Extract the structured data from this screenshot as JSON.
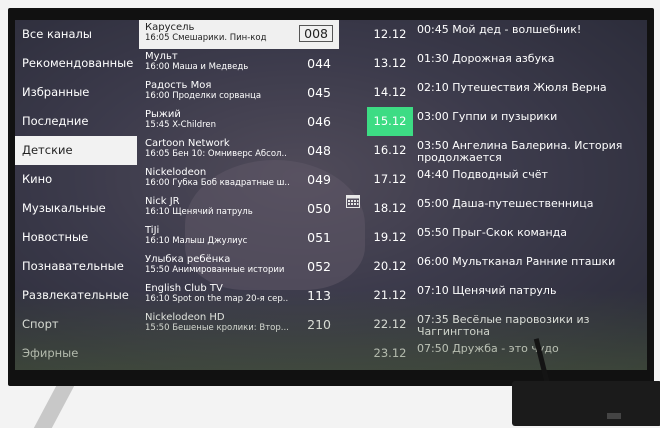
{
  "categories": [
    {
      "label": "Все каналы"
    },
    {
      "label": "Рекомендованные"
    },
    {
      "label": "Избранные"
    },
    {
      "label": "Последние"
    },
    {
      "label": "Детские",
      "active": true
    },
    {
      "label": "Кино"
    },
    {
      "label": "Музыкальные"
    },
    {
      "label": "Новостные"
    },
    {
      "label": "Познавательные"
    },
    {
      "label": "Развлекательные"
    },
    {
      "label": "Спорт"
    },
    {
      "label": "Эфирные"
    }
  ],
  "channels": [
    {
      "name": "Карусель",
      "program": "16:05 Смешарики. Пин-код",
      "number": "008",
      "active": true
    },
    {
      "name": "Мульт",
      "program": "16:00 Маша и Медведь",
      "number": "044"
    },
    {
      "name": "Радость Моя",
      "program": "16:00 Проделки сорванца",
      "number": "045"
    },
    {
      "name": "Рыжий",
      "program": "15:45 X-Children",
      "number": "046"
    },
    {
      "name": "Cartoon Network",
      "program": "16:05 Бен 10: Омниверс Абсол..",
      "number": "048"
    },
    {
      "name": "Nickelodeon",
      "program": "16:00 Губка Боб квадратные ш..",
      "number": "049"
    },
    {
      "name": "Nick JR",
      "program": "16:10 Щенячий патруль",
      "number": "050"
    },
    {
      "name": "TiJi",
      "program": "16:10 Малыш Джулиус",
      "number": "051"
    },
    {
      "name": "Улыбка ребёнка",
      "program": "15:50 Анимированные истории",
      "number": "052"
    },
    {
      "name": "English Club TV",
      "program": "16:10 Spot on the map 20-я сер..",
      "number": "113"
    },
    {
      "name": "Nickelodeon HD",
      "program": "15:50 Бешеные кролики: Втор...",
      "number": "210"
    }
  ],
  "schedule": [
    {
      "date": "12.12",
      "show": "00:45 Мой дед - волшебник!"
    },
    {
      "date": "13.12",
      "show": "01:30 Дорожная азбука"
    },
    {
      "date": "14.12",
      "show": "02:10 Путешествия Жюля Верна"
    },
    {
      "date": "15.12",
      "show": "03:00 Гуппи и пузырики",
      "active": true
    },
    {
      "date": "16.12",
      "show": "03:50 Ангелина Балерина. История продолжается"
    },
    {
      "date": "17.12",
      "show": "04:40 Подводный счёт"
    },
    {
      "date": "18.12",
      "show": "05:00 Даша-путешественница"
    },
    {
      "date": "19.12",
      "show": "05:50 Прыг-Скок команда"
    },
    {
      "date": "20.12",
      "show": "06:00 Мультканал Ранние пташки"
    },
    {
      "date": "21.12",
      "show": "07:10 Щенячий патруль"
    },
    {
      "date": "22.12",
      "show": "07:35 Весёлые паровозики из Чаггингтона"
    },
    {
      "date": "23.12",
      "show": "07:50 Дружба - это чудо"
    }
  ],
  "colors": {
    "active_date": "#3ddc84",
    "active_row": "#f2f2f2"
  }
}
